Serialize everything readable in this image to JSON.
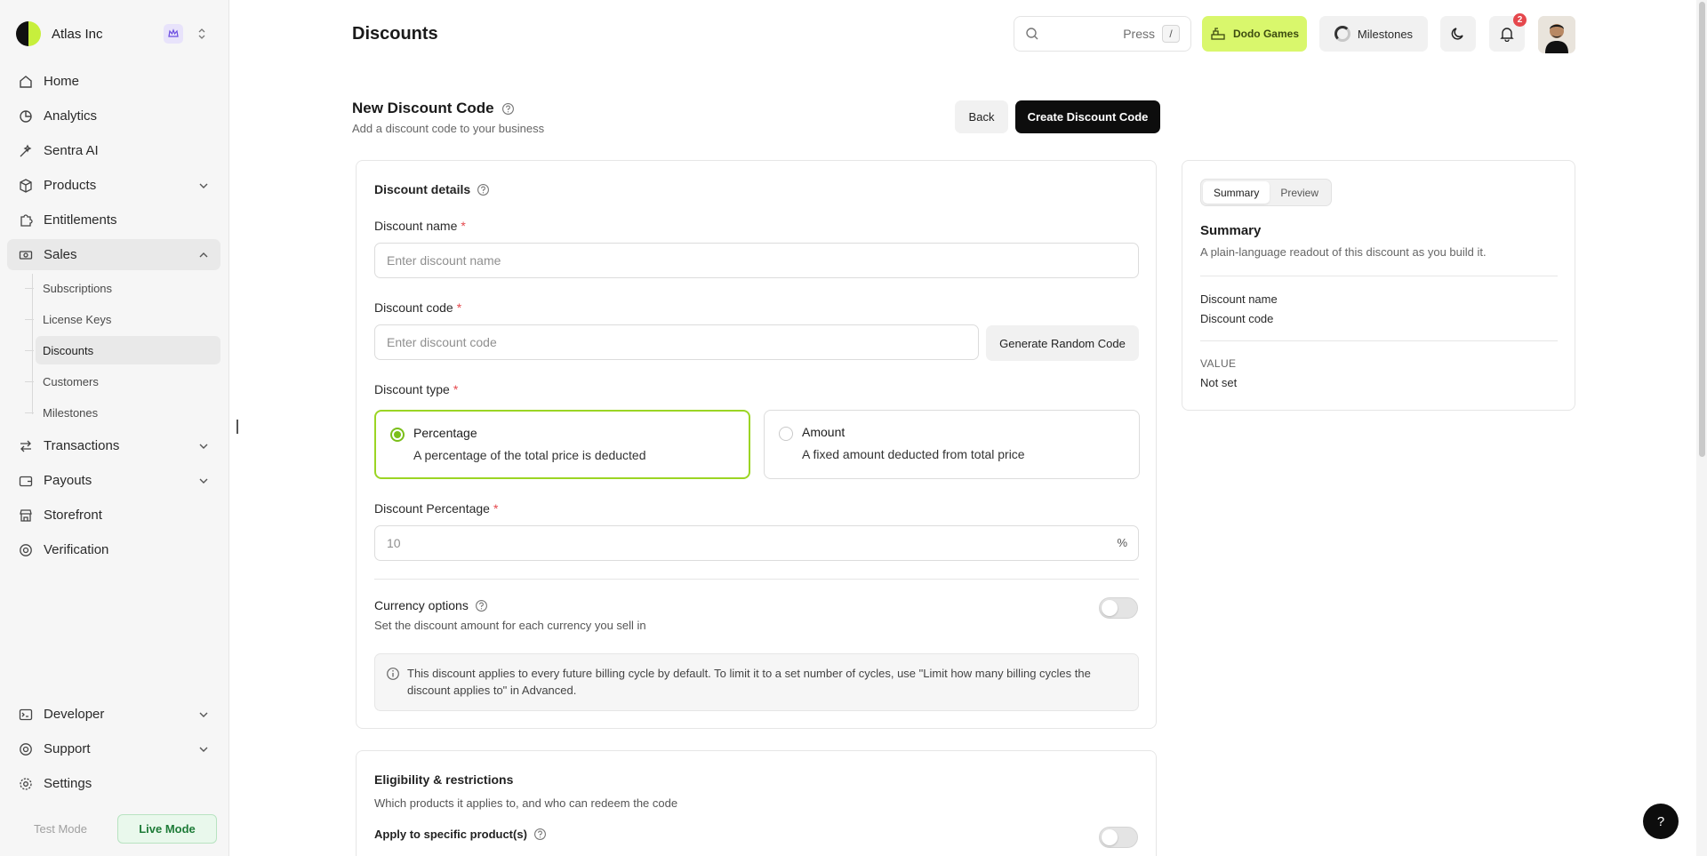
{
  "brand": {
    "name": "Atlas Inc"
  },
  "sidebar": {
    "items": [
      {
        "label": "Home",
        "icon": "home-icon"
      },
      {
        "label": "Analytics",
        "icon": "analytics-icon"
      },
      {
        "label": "Sentra AI",
        "icon": "sparkle-icon"
      },
      {
        "label": "Products",
        "icon": "box-icon",
        "expandable": true
      },
      {
        "label": "Entitlements",
        "icon": "puzzle-icon"
      },
      {
        "label": "Sales",
        "icon": "cash-icon",
        "expanded": true
      },
      {
        "label": "Transactions",
        "icon": "arrows-icon",
        "expandable": true
      },
      {
        "label": "Payouts",
        "icon": "wallet-icon",
        "expandable": true
      },
      {
        "label": "Storefront",
        "icon": "store-icon"
      },
      {
        "label": "Verification",
        "icon": "verify-icon"
      }
    ],
    "sales_sub": [
      "Subscriptions",
      "License Keys",
      "Discounts",
      "Customers",
      "Milestones"
    ],
    "bottom": [
      {
        "label": "Developer",
        "icon": "terminal-icon"
      },
      {
        "label": "Support",
        "icon": "support-icon"
      },
      {
        "label": "Settings",
        "icon": "gear-icon"
      }
    ],
    "mode": {
      "test": "Test Mode",
      "live": "Live Mode"
    }
  },
  "topbar": {
    "title": "Discounts",
    "search_press": "Press",
    "search_key": "/",
    "store": "Dodo Games",
    "milestones": "Milestones",
    "notifications": "2"
  },
  "form": {
    "title": "New Discount Code",
    "subtitle": "Add a discount code to your business",
    "back": "Back",
    "create": "Create Discount Code",
    "section": "Discount details",
    "name_label": "Discount name",
    "name_placeholder": "Enter discount name",
    "code_label": "Discount code",
    "code_placeholder": "Enter discount code",
    "generate": "Generate Random Code",
    "type_label": "Discount type",
    "type_percentage": "Percentage",
    "type_percentage_desc": "A percentage of the total price is deducted",
    "type_amount": "Amount",
    "type_amount_desc": "A fixed amount deducted from total price",
    "pct_label": "Discount Percentage",
    "pct_placeholder": "10",
    "pct_symbol": "%",
    "currency_title": "Currency options",
    "currency_desc": "Set the discount amount for each currency you sell in",
    "info": "This discount applies to every future billing cycle by default. To limit it to a set number of cycles, use \"Limit how many billing cycles the discount applies to\" in Advanced.",
    "elig_title": "Eligibility & restrictions",
    "elig_desc": "Which products it applies to, and who can redeem the code",
    "apply_specific": "Apply to specific product(s)"
  },
  "summary": {
    "tab_summary": "Summary",
    "tab_preview": "Preview",
    "title": "Summary",
    "subtitle": "A plain-language readout of this discount as you build it.",
    "name_row": "Discount name",
    "code_row": "Discount code",
    "value_label": "VALUE",
    "value": "Not set"
  },
  "help": "?"
}
